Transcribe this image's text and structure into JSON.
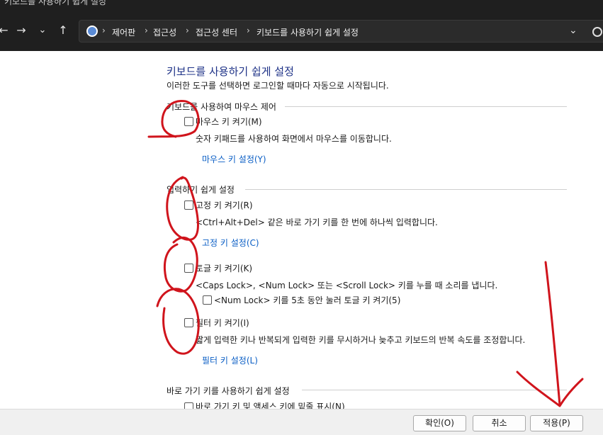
{
  "window": {
    "title": "키보드를 사용하기 쉽게 설정"
  },
  "nav": {
    "back_icon": "arrow-left-icon",
    "forward_icon": "arrow-right-icon",
    "recent_icon": "chevron-down-icon",
    "up_icon": "arrow-up-icon"
  },
  "breadcrumbs": [
    "제어판",
    "접근성",
    "접근성 센터",
    "키보드를 사용하기 쉽게 설정"
  ],
  "page": {
    "heading": "키보드를 사용하기 쉽게 설정",
    "description": "이러한 도구를 선택하면 로그인할 때마다 자동으로 시작됩니다."
  },
  "mouse_group": {
    "title": "키보드를 사용하여 마우스 제어",
    "mouse_keys_label": "마우스 키 켜기(M)",
    "mouse_keys_desc": "숫자 키패드를 사용하여 화면에서 마우스를 이동합니다.",
    "mouse_keys_link": "마우스 키 설정(Y)"
  },
  "typing_group": {
    "title": "입력하기 쉽게 설정",
    "sticky_label": "고정 키 켜기(R)",
    "sticky_desc": "<Ctrl+Alt+Del> 같은 바로 가기 키를 한 번에 하나씩 입력합니다.",
    "sticky_link": "고정 키 설정(C)",
    "toggle_label": "토글 키 켜기(K)",
    "toggle_desc": "<Caps Lock>, <Num Lock> 또는 <Scroll Lock> 키를 누를 때 소리를 냅니다.",
    "toggle_sub_label": "<Num Lock> 키를 5초 동안 눌러 토글 키 켜기(5)",
    "filter_label": "필터 키 켜기(I)",
    "filter_desc": "짧게 입력한 키나 반복되게 입력한 키를 무시하거나 늦추고 키보드의 반복 속도를 조정합니다.",
    "filter_link": "필터 키 설정(L)"
  },
  "shortcut_group": {
    "title": "바로 가기 키를 사용하기 쉽게 설정",
    "underline_label": "바로 가기 키 및 액세스 키에 밑줄 표시(N)"
  },
  "footer": {
    "ok": "확인(O)",
    "cancel": "취소",
    "apply": "적용(P)"
  },
  "annotation_color": "#d0141c"
}
